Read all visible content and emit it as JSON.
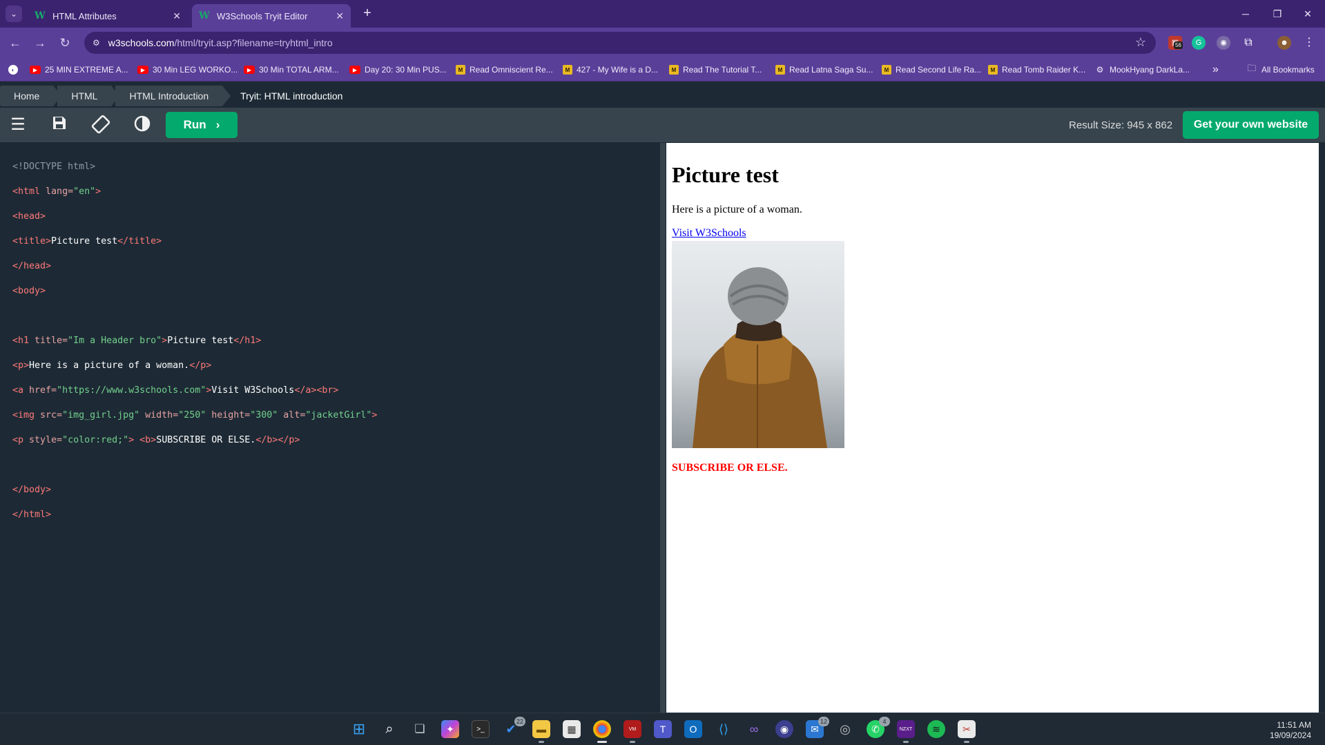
{
  "browser": {
    "tabs": [
      {
        "title": "HTML Attributes",
        "favicon": "w3schools-icon",
        "active": false
      },
      {
        "title": "W3Schools Tryit Editor",
        "favicon": "w3schools-icon",
        "active": true
      }
    ],
    "url_host": "w3schools.com",
    "url_path": "/html/tryit.asp?filename=tryhtml_intro",
    "bookmarks": [
      {
        "label": "25 MIN EXTREME A...",
        "icon": "youtube-icon"
      },
      {
        "label": "30 Min LEG WORKO...",
        "icon": "youtube-icon"
      },
      {
        "label": "30 Min TOTAL ARM...",
        "icon": "youtube-icon"
      },
      {
        "label": "Day 20: 30 Min PUS...",
        "icon": "youtube-icon"
      },
      {
        "label": "Read Omniscient Re...",
        "icon": "manga-icon"
      },
      {
        "label": "427 - My Wife is a D...",
        "icon": "manga-icon"
      },
      {
        "label": "Read The Tutorial T...",
        "icon": "manga-icon"
      },
      {
        "label": "Read Latna Saga Su...",
        "icon": "manga-icon"
      },
      {
        "label": "Read Second Life Ra...",
        "icon": "manga-icon"
      },
      {
        "label": "Read Tomb Raider K...",
        "icon": "manga-icon"
      },
      {
        "label": "MookHyang DarkLa...",
        "icon": "gear-icon"
      }
    ],
    "all_bookmarks": "All Bookmarks",
    "extension_badge": "56"
  },
  "w3": {
    "breadcrumbs": [
      "Home",
      "HTML",
      "HTML Introduction"
    ],
    "breadcrumb_current": "Tryit: HTML introduction",
    "run_label": "Run",
    "result_size": "Result Size: 945 x 862",
    "own_website": "Get your own website"
  },
  "editor": {
    "l1": "<!DOCTYPE html>",
    "l2_open": "<html ",
    "l2_attr": "lang=",
    "l2_val": "\"en\"",
    "l2_close": ">",
    "l3": "<head>",
    "l4_open": "<title>",
    "l4_text": "Picture test",
    "l4_close": "</title>",
    "l5": "</head>",
    "l6": "<body>",
    "l8_open": "<h1 ",
    "l8_attr": "title=",
    "l8_val": "\"Im a Header bro\"",
    "l8_gt": ">",
    "l8_text": "Picture test",
    "l8_close": "</h1>",
    "l9_open": "<p>",
    "l9_text": "Here is a picture of a woman.",
    "l9_close": "</p>",
    "l10_open": "<a ",
    "l10_attr": "href=",
    "l10_val": "\"https://www.w3schools.com\"",
    "l10_gt": ">",
    "l10_text": "Visit W3Schools",
    "l10_close": "</a><br>",
    "l11_open": "<img ",
    "l11_a1": "src=",
    "l11_v1": "\"img_girl.jpg\"",
    "l11_a2": " width=",
    "l11_v2": "\"250\"",
    "l11_a3": " height=",
    "l11_v3": "\"300\"",
    "l11_a4": " alt=",
    "l11_v4": "\"jacketGirl\"",
    "l11_gt": ">",
    "l12_open": "<p ",
    "l12_attr": "style=",
    "l12_val": "\"color:red;\"",
    "l12_gt": "> ",
    "l12_b": "<b>",
    "l12_text": "SUBSCRIBE OR ELSE.",
    "l12_close": "</b></p>",
    "l14": "</body>",
    "l15": "</html>"
  },
  "result": {
    "heading": "Picture test",
    "paragraph": "Here is a picture of a woman.",
    "link": "Visit W3Schools",
    "image_alt": "jacketGirl",
    "red_text": "SUBSCRIBE OR ELSE."
  },
  "taskbar": {
    "todo_badge": "22",
    "mail_badge": "12",
    "whatsapp_badge": "4",
    "time": "11:51 AM",
    "date": "19/09/2024"
  },
  "colors": {
    "chrome_dark": "#3b2370",
    "chrome_light": "#5a3f99",
    "w3_green": "#04aa6d",
    "editor_bg": "#1d2a35",
    "toolbar_bg": "#38444d"
  }
}
